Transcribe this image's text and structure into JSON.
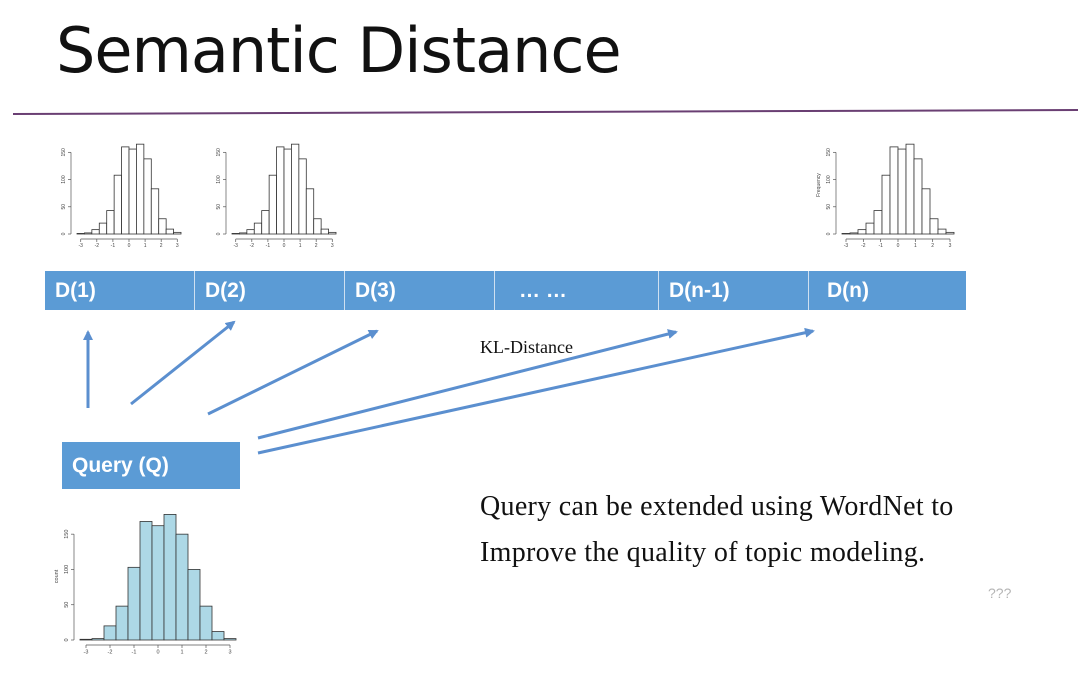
{
  "slide": {
    "title": "Semantic Distance",
    "kl_label": "KL-Distance",
    "note_line1": "Query can be extended using WordNet to",
    "note_line2": "Improve the quality of topic modeling.",
    "question_marks": "???"
  },
  "documents": [
    "D(1)",
    "D(2)",
    "D(3)",
    "… …",
    "D(n-1)",
    "D(n)"
  ],
  "query_label": "Query (Q)",
  "colors": {
    "bar_blue": "#5b9bd5",
    "arrow_blue": "#5b8fcf",
    "rule_purple": "#6a3f73",
    "query_hist_fill": "#add8e6"
  },
  "histograms": {
    "doc_hist": {
      "bin_counts": [
        1,
        2,
        8,
        20,
        43,
        108,
        160,
        156,
        165,
        138,
        83,
        28,
        9,
        3
      ],
      "x_ticks": [
        "-3",
        "-2",
        "-1",
        "0",
        "1",
        "2",
        "3"
      ],
      "y_ticks": [
        "0",
        "50",
        "100",
        "150"
      ],
      "y_label_dn": "Frequency"
    },
    "query_hist": {
      "bin_counts": [
        1,
        2,
        20,
        48,
        103,
        168,
        162,
        178,
        150,
        100,
        48,
        12,
        2
      ],
      "x_ticks": [
        "-3",
        "-2",
        "-1",
        "0",
        "1",
        "2",
        "3"
      ],
      "y_ticks": [
        "0",
        "50",
        "100",
        "150"
      ],
      "y_label": "count"
    }
  }
}
